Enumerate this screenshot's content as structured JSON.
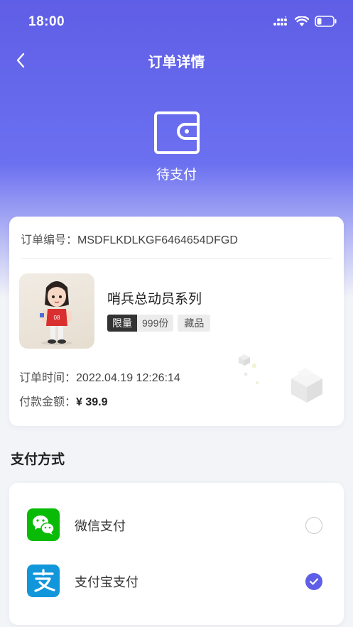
{
  "status_bar": {
    "time": "18:00"
  },
  "nav": {
    "title": "订单详情"
  },
  "order_status": {
    "text": "待支付"
  },
  "order": {
    "number_label": "订单编号：",
    "number": "MSDFLKDLKGF6464654DFGD",
    "product_name": "哨兵总动员系列",
    "tag_limit": "限量",
    "tag_count": "999份",
    "tag_type": "藏品",
    "time_label": "订单时间：",
    "time": "2022.04.19 12:26:14",
    "amount_label": "付款金额：",
    "amount": "¥ 39.9"
  },
  "payment": {
    "section_title": "支付方式",
    "methods": [
      {
        "label": "微信支付",
        "icon": "wechat-pay-icon",
        "selected": false
      },
      {
        "label": "支付宝支付",
        "icon": "alipay-icon",
        "selected": true
      }
    ]
  },
  "colors": {
    "accent": "#5f5ee6",
    "wechat": "#09bb07",
    "alipay": "#1296db"
  }
}
